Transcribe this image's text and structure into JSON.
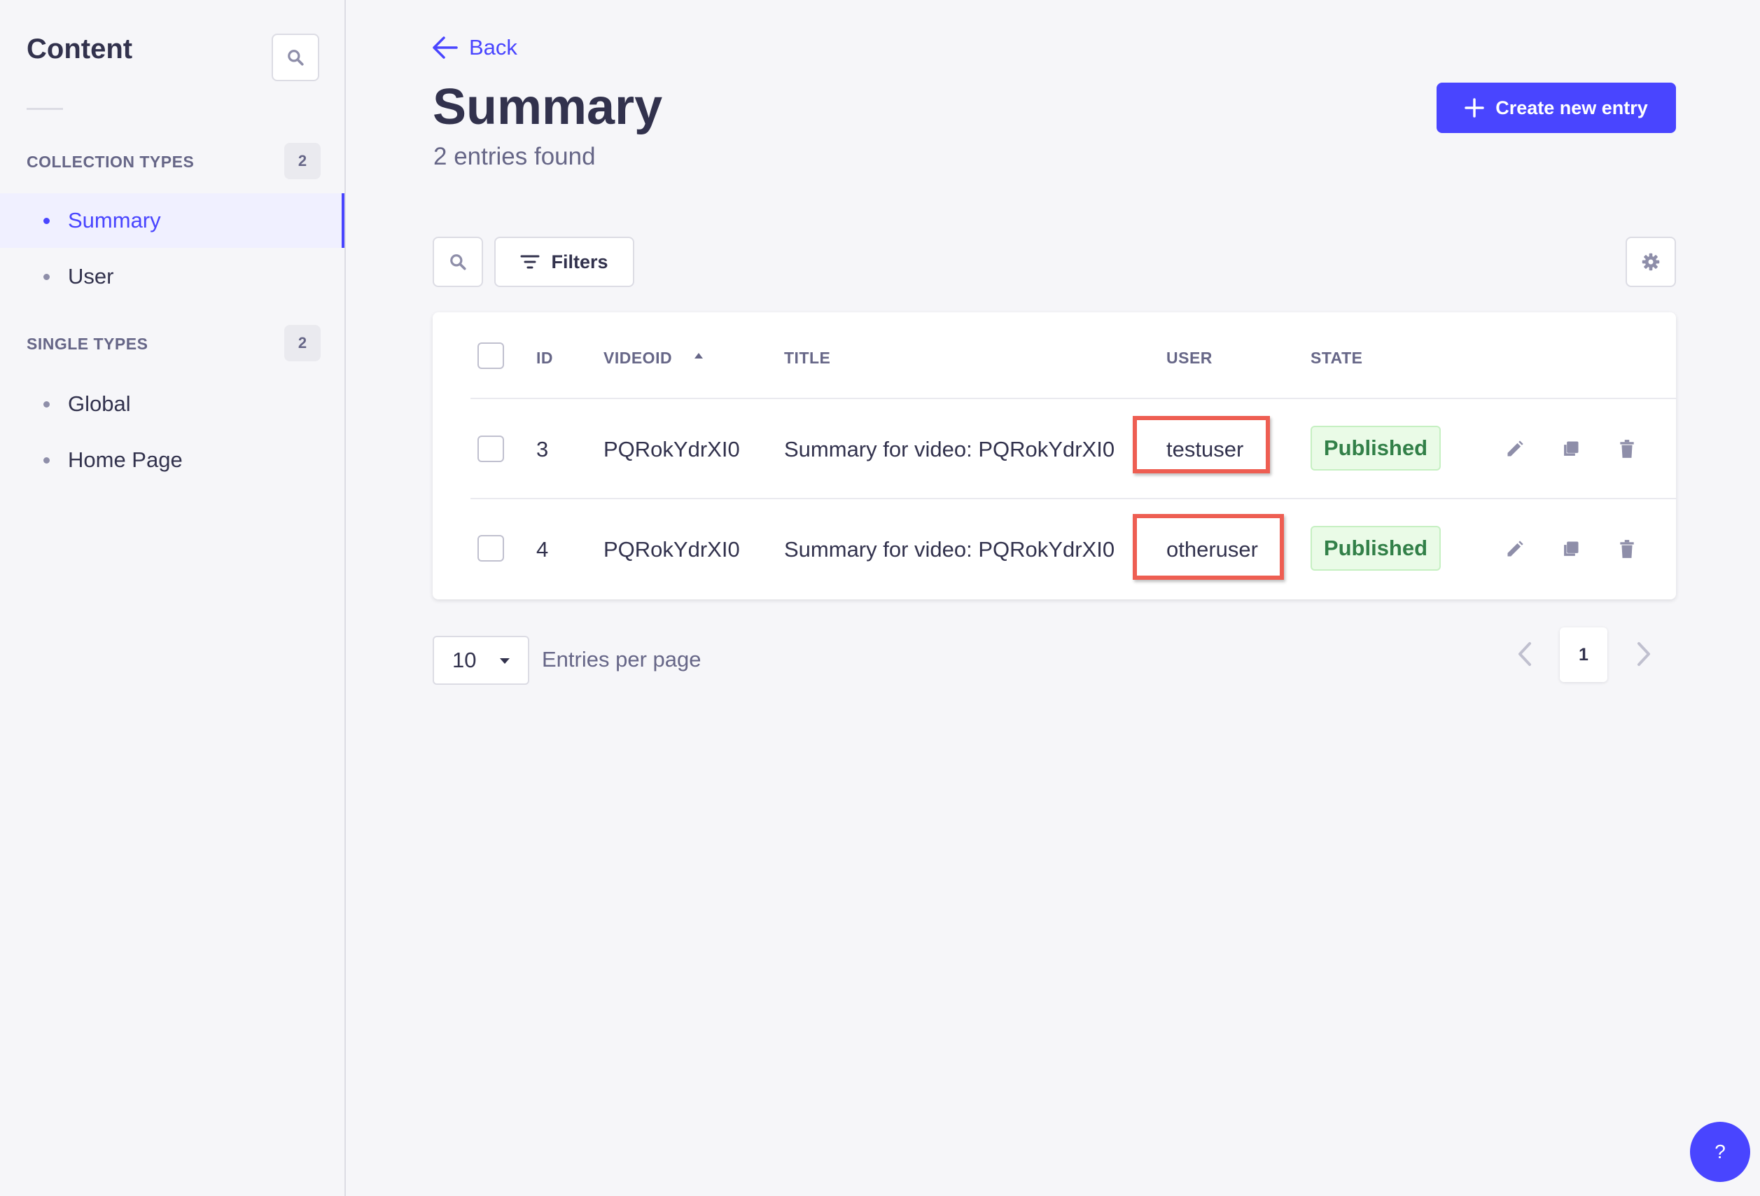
{
  "sidebar": {
    "title": "Content",
    "sections": [
      {
        "label": "COLLECTION TYPES",
        "count": "2",
        "items": [
          {
            "label": "Summary",
            "active": true
          },
          {
            "label": "User",
            "active": false
          }
        ]
      },
      {
        "label": "SINGLE TYPES",
        "count": "2",
        "items": [
          {
            "label": "Global",
            "active": false
          },
          {
            "label": "Home Page",
            "active": false
          }
        ]
      }
    ]
  },
  "header": {
    "back_label": "Back",
    "title": "Summary",
    "subtitle": "2 entries found",
    "create_label": "Create new entry"
  },
  "toolbar": {
    "filters_label": "Filters"
  },
  "table": {
    "columns": [
      "ID",
      "VIDEOID",
      "TITLE",
      "USER",
      "STATE"
    ],
    "sort": {
      "column": "VIDEOID",
      "direction": "asc"
    },
    "rows": [
      {
        "id": "3",
        "videoid": "PQRokYdrXI0",
        "title": "Summary for video: PQRokYdrXI0",
        "user": "testuser",
        "state": "Published"
      },
      {
        "id": "4",
        "videoid": "PQRokYdrXI0",
        "title": "Summary for video: PQRokYdrXI0",
        "user": "otheruser",
        "state": "Published"
      }
    ]
  },
  "pagination": {
    "per_page": "10",
    "per_page_label": "Entries per page",
    "current_page": "1"
  },
  "help_label": "?",
  "colors": {
    "accent": "#4945ff",
    "highlight": "#ee5e52",
    "published_text": "#328048",
    "published_bg": "#eafbe7"
  }
}
